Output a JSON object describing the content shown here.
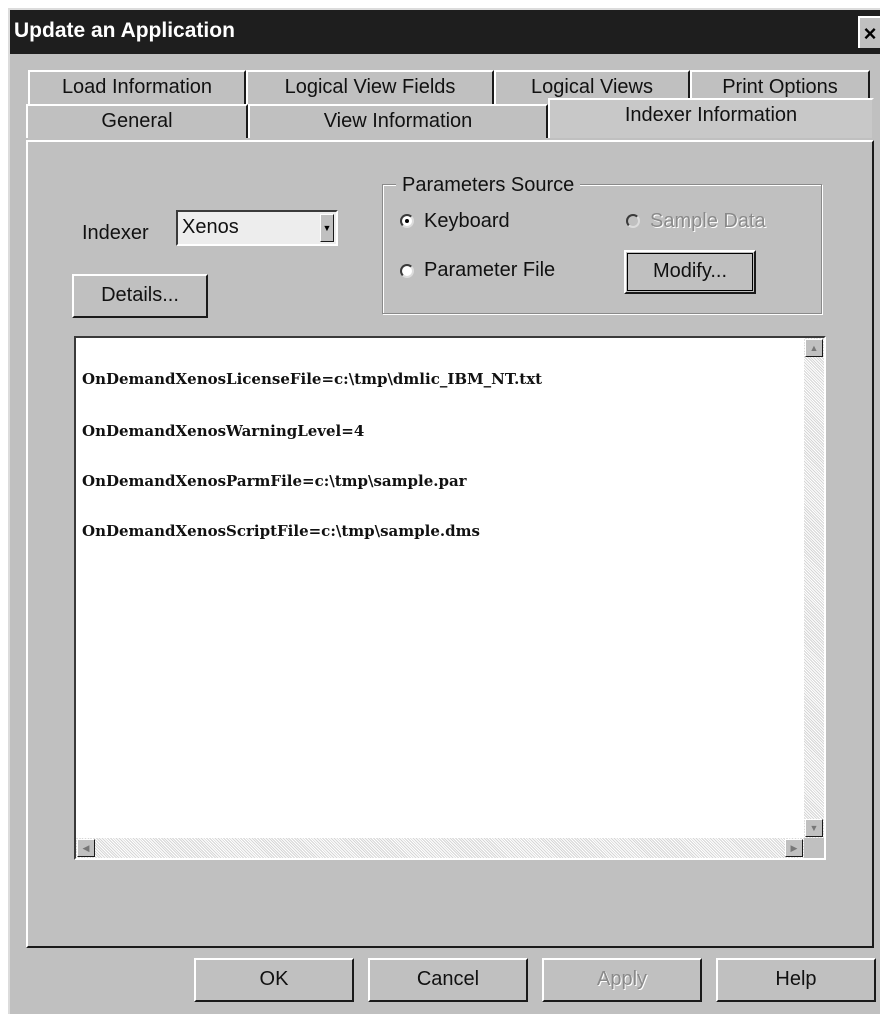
{
  "window": {
    "title": "Update an Application",
    "close_glyph": "×"
  },
  "tabs": {
    "row_back": [
      "Load Information",
      "Logical View Fields",
      "Logical Views",
      "Print Options"
    ],
    "row_front": [
      "General",
      "View Information",
      "Indexer Information"
    ],
    "selected": "Indexer Information"
  },
  "indexer": {
    "label": "Indexer",
    "value": "Xenos",
    "details_label": "Details..."
  },
  "parameters_source": {
    "title": "Parameters Source",
    "keyboard_label": "Keyboard",
    "sample_data_label": "Sample Data",
    "parameter_file_label": "Parameter File",
    "modify_label": "Modify...",
    "selected": "Keyboard"
  },
  "editor": {
    "lines": [
      "OnDemandXenosLicenseFile=c:\\tmp\\dmlic_IBM_NT.txt",
      "OnDemandXenosWarningLevel=4",
      "OnDemandXenosParmFile=c:\\tmp\\sample.par",
      "OnDemandXenosScriptFile=c:\\tmp\\sample.dms"
    ]
  },
  "footer": {
    "ok_label": "OK",
    "cancel_label": "Cancel",
    "apply_label": "Apply",
    "help_label": "Help"
  }
}
